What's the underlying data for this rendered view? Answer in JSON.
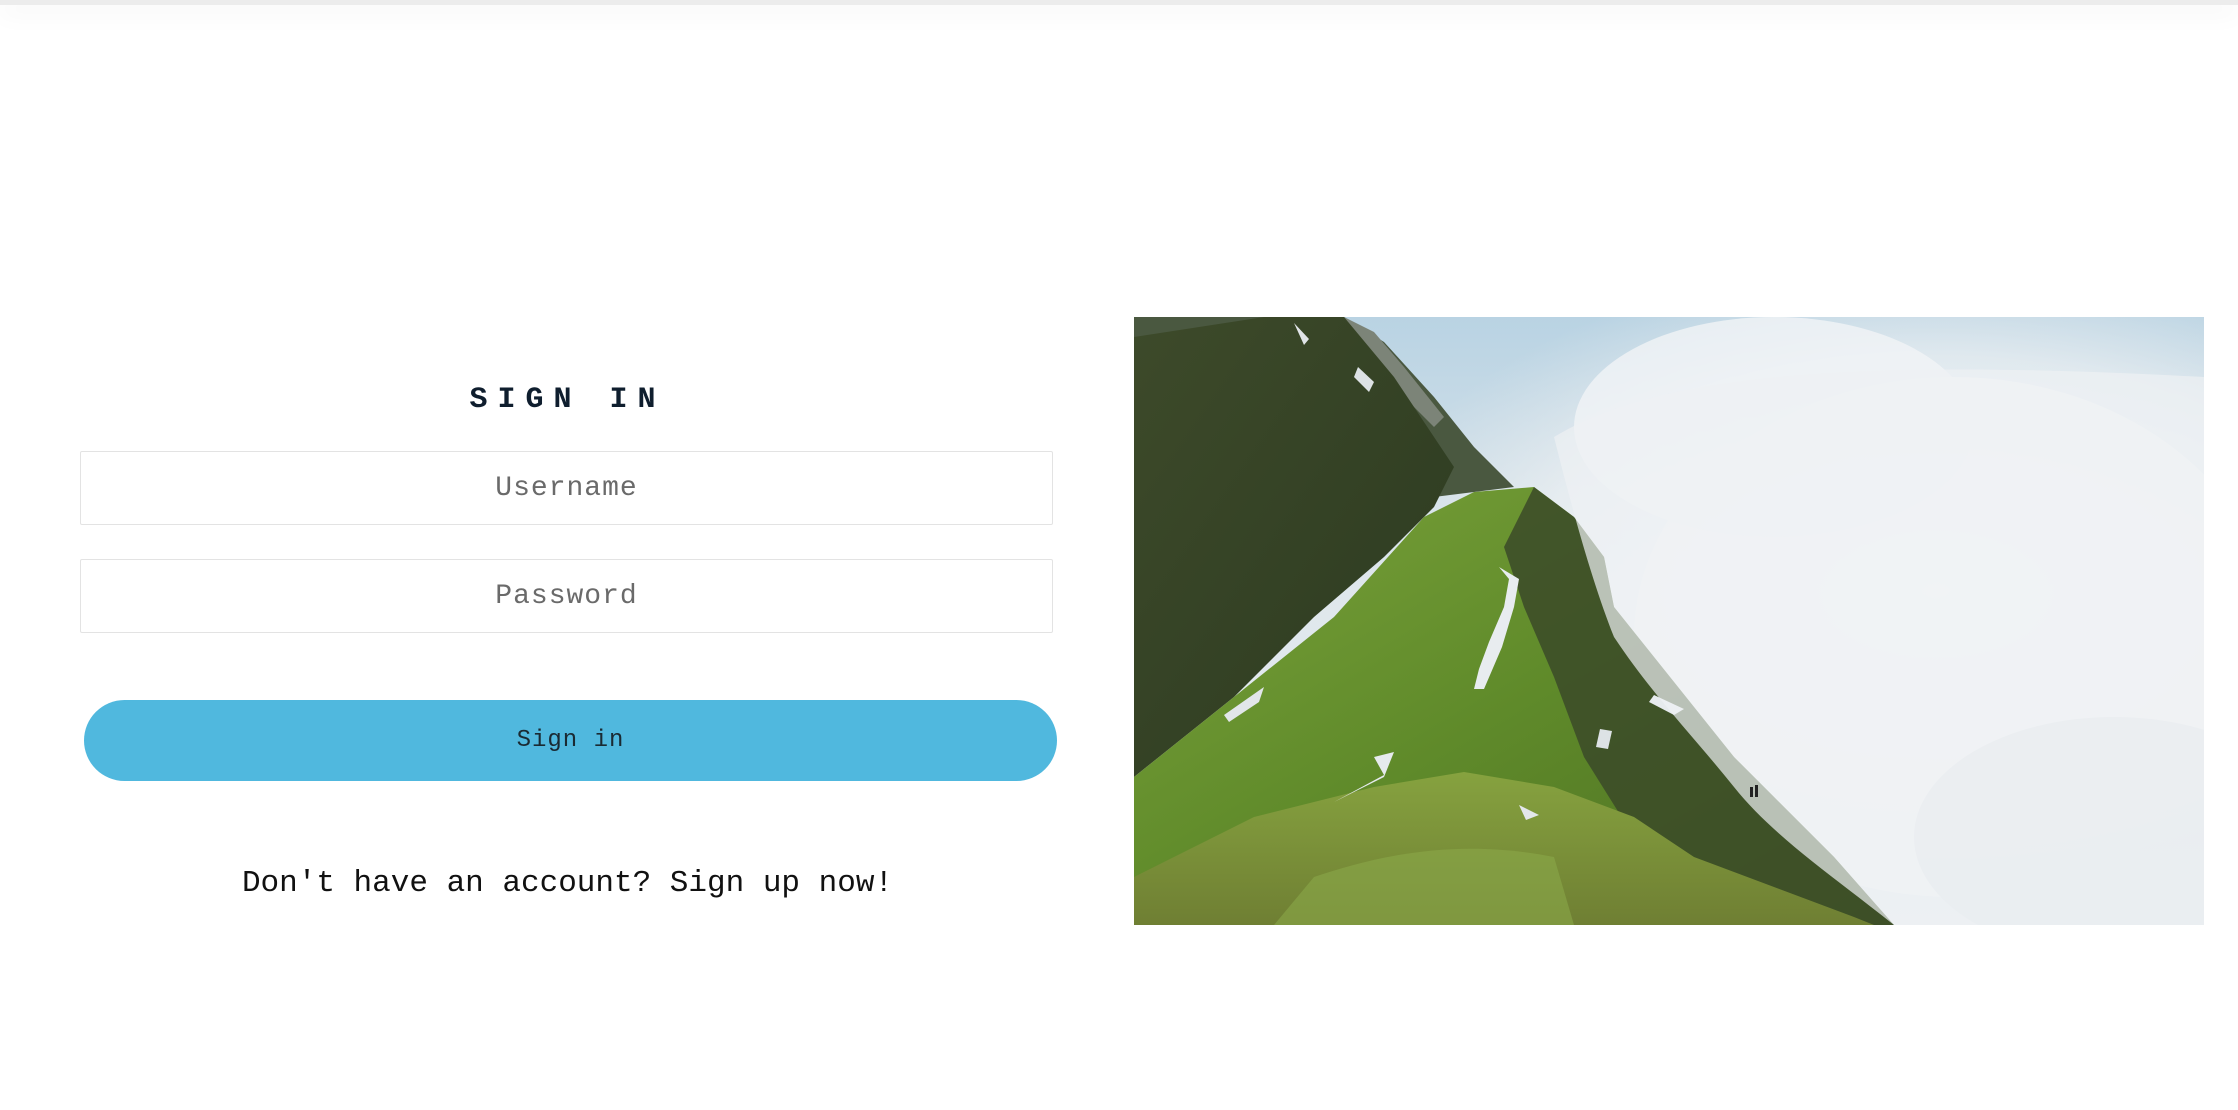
{
  "signin": {
    "title": "SIGN IN",
    "username_placeholder": "Username",
    "password_placeholder": "Password",
    "button_label": "Sign in",
    "signup_text": "Don't have an account? Sign up now!"
  },
  "colors": {
    "button": "#50b8de",
    "title": "#0f1e2e",
    "field_border": "#e3e3e3"
  },
  "hero": {
    "subject": "mountain-ridge-photo"
  }
}
